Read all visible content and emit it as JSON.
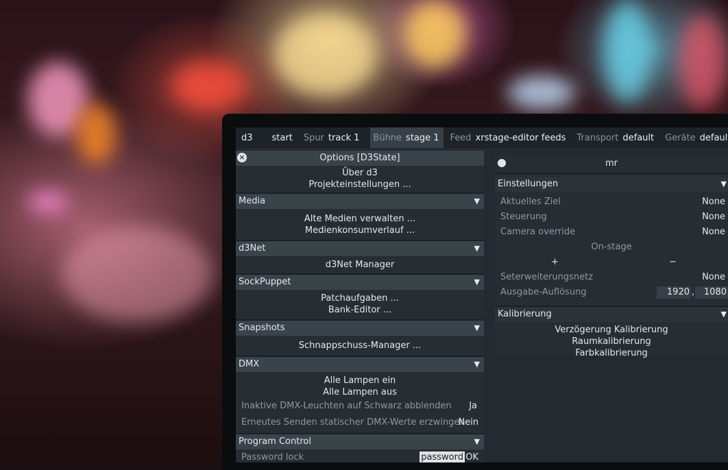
{
  "topbar": {
    "app": "d3",
    "start": "start",
    "track_label": "Spur",
    "track_value": "track 1",
    "stage_label": "Bühne",
    "stage_value": "stage 1",
    "feed_label": "Feed",
    "feed_value": "xrstage-editor feeds",
    "transport_label": "Transport",
    "transport_value": "default",
    "devices_label": "Geräte",
    "devices_value": "default"
  },
  "options": {
    "title": "Options [D3State]",
    "top_items": [
      "Über d3",
      "Projekteinstellungen ..."
    ],
    "media": {
      "title": "Media",
      "items": [
        "Alte Medien verwalten ...",
        "Medienkonsumverlauf ..."
      ]
    },
    "d3net": {
      "title": "d3Net",
      "items": [
        "d3Net Manager"
      ]
    },
    "sockpuppet": {
      "title": "SockPuppet",
      "items": [
        "Patchaufgaben ...",
        "Bank-Editor ..."
      ]
    },
    "snapshots": {
      "title": "Snapshots",
      "items": [
        "Schnappschuss-Manager ..."
      ]
    },
    "dmx": {
      "title": "DMX",
      "items": [
        "Alle Lampen ein",
        "Alle Lampen aus"
      ],
      "rows": [
        {
          "label": "Inaktive DMX-Leuchten auf Schwarz abblenden",
          "value": "Ja"
        },
        {
          "label": "Erneutes Senden statischer DMX-Werte erzwingen",
          "value": "Nein"
        }
      ]
    },
    "program_control": {
      "title": "Program Control",
      "password_label": "Password lock",
      "password_value": "password",
      "ok": "OK"
    }
  },
  "mr": {
    "title": "mr",
    "settings": {
      "title": "Einstellungen",
      "rows": [
        {
          "label": "Aktuelles Ziel",
          "value": "None"
        },
        {
          "label": "Steuerung",
          "value": "None"
        },
        {
          "label": "Camera override",
          "value": "None"
        }
      ],
      "onstage": "On-stage",
      "plus": "+",
      "minus": "−",
      "extension_label": "Seterweiterungsnetz",
      "extension_value": "None",
      "resolution_label": "Ausgabe-Auflösung",
      "res_w": "1920",
      "res_sep": ",",
      "res_h": "1080"
    },
    "calibration": {
      "title": "Kalibrierung",
      "items": [
        "Verzögerung Kalibrierung",
        "Raumkalibrierung",
        "Farbkalibrierung"
      ]
    }
  },
  "icons": {
    "close": "close-icon",
    "pin": "pin-icon",
    "collapse": "chevron-down-icon"
  }
}
